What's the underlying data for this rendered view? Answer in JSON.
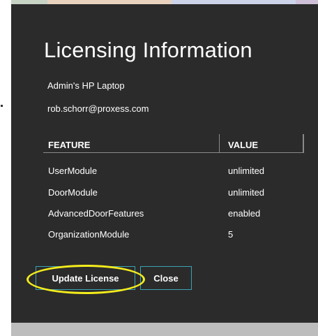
{
  "dialog": {
    "title": "Licensing Information",
    "device_name": "Admin's HP Laptop",
    "email": "rob.schorr@proxess.com"
  },
  "table": {
    "headers": {
      "feature": "FEATURE",
      "value": "VALUE"
    },
    "rows": [
      {
        "feature": "UserModule",
        "value": "unlimited"
      },
      {
        "feature": "DoorModule",
        "value": "unlimited"
      },
      {
        "feature": "AdvancedDoorFeatures",
        "value": "enabled"
      },
      {
        "feature": "OrganizationModule",
        "value": "5"
      }
    ]
  },
  "buttons": {
    "update_license": "Update License",
    "close": "Close"
  },
  "colors": {
    "dialog_background": "#2b2b2b",
    "button_border": "#3aa3b4",
    "highlight_ellipse": "#f4ec1c"
  }
}
